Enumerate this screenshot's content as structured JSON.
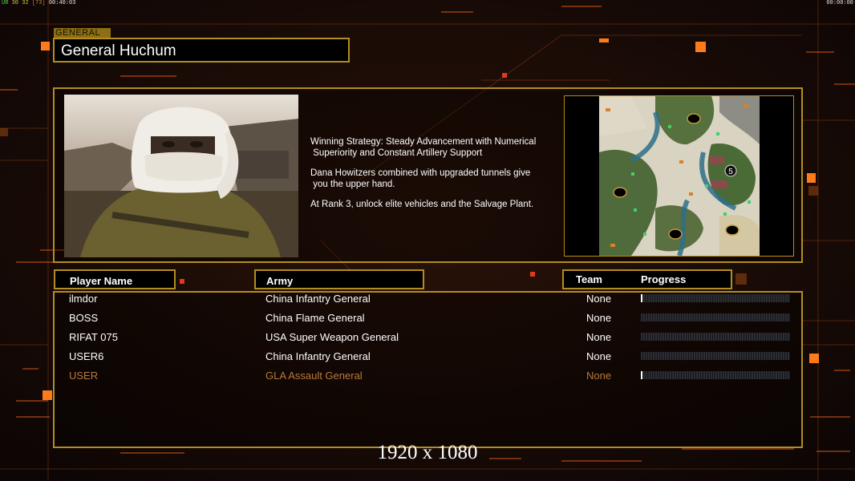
{
  "hud": {
    "fps_prefix": "UR",
    "fps_a": "30",
    "fps_b": "32",
    "fps_c": "[73]",
    "clock_left": "00:40:03",
    "clock_right": "00:00:00"
  },
  "general": {
    "tag": "GENERAL",
    "name": "General Huchum",
    "portrait_icon": "masked-soldier-portrait",
    "strategy": [
      "Winning Strategy: Steady Advancement with Numerical\n Superiority and Constant Artillery Support",
      "Dana Howitzers combined with upgraded tunnels give\n you the upper hand.",
      "At Rank 3, unlock elite vehicles and the Salvage Plant."
    ],
    "map_icon": "minimap",
    "map_marker": "5"
  },
  "table": {
    "headers": {
      "player": "Player Name",
      "army": "Army",
      "team": "Team",
      "progress": "Progress"
    },
    "rows": [
      {
        "player": "ilmdor",
        "army": "China Infantry General",
        "team": "None",
        "progress": 0.01
      },
      {
        "player": "BOSS",
        "army": "China Flame General",
        "team": "None",
        "progress": 0
      },
      {
        "player": "RIFAT 075",
        "army": "USA Super Weapon General",
        "team": "None",
        "progress": 0
      },
      {
        "player": "USER6",
        "army": "China Infantry General",
        "team": "None",
        "progress": 0
      },
      {
        "player": "USER",
        "army": "GLA Assault General",
        "team": "None",
        "progress": 0.01
      }
    ]
  },
  "overlay": {
    "resolution": "1920 x 1080"
  },
  "colors": {
    "gold": "#b38d1f",
    "accent_orange": "#ff7a1a",
    "local_player": "#b8793b"
  }
}
